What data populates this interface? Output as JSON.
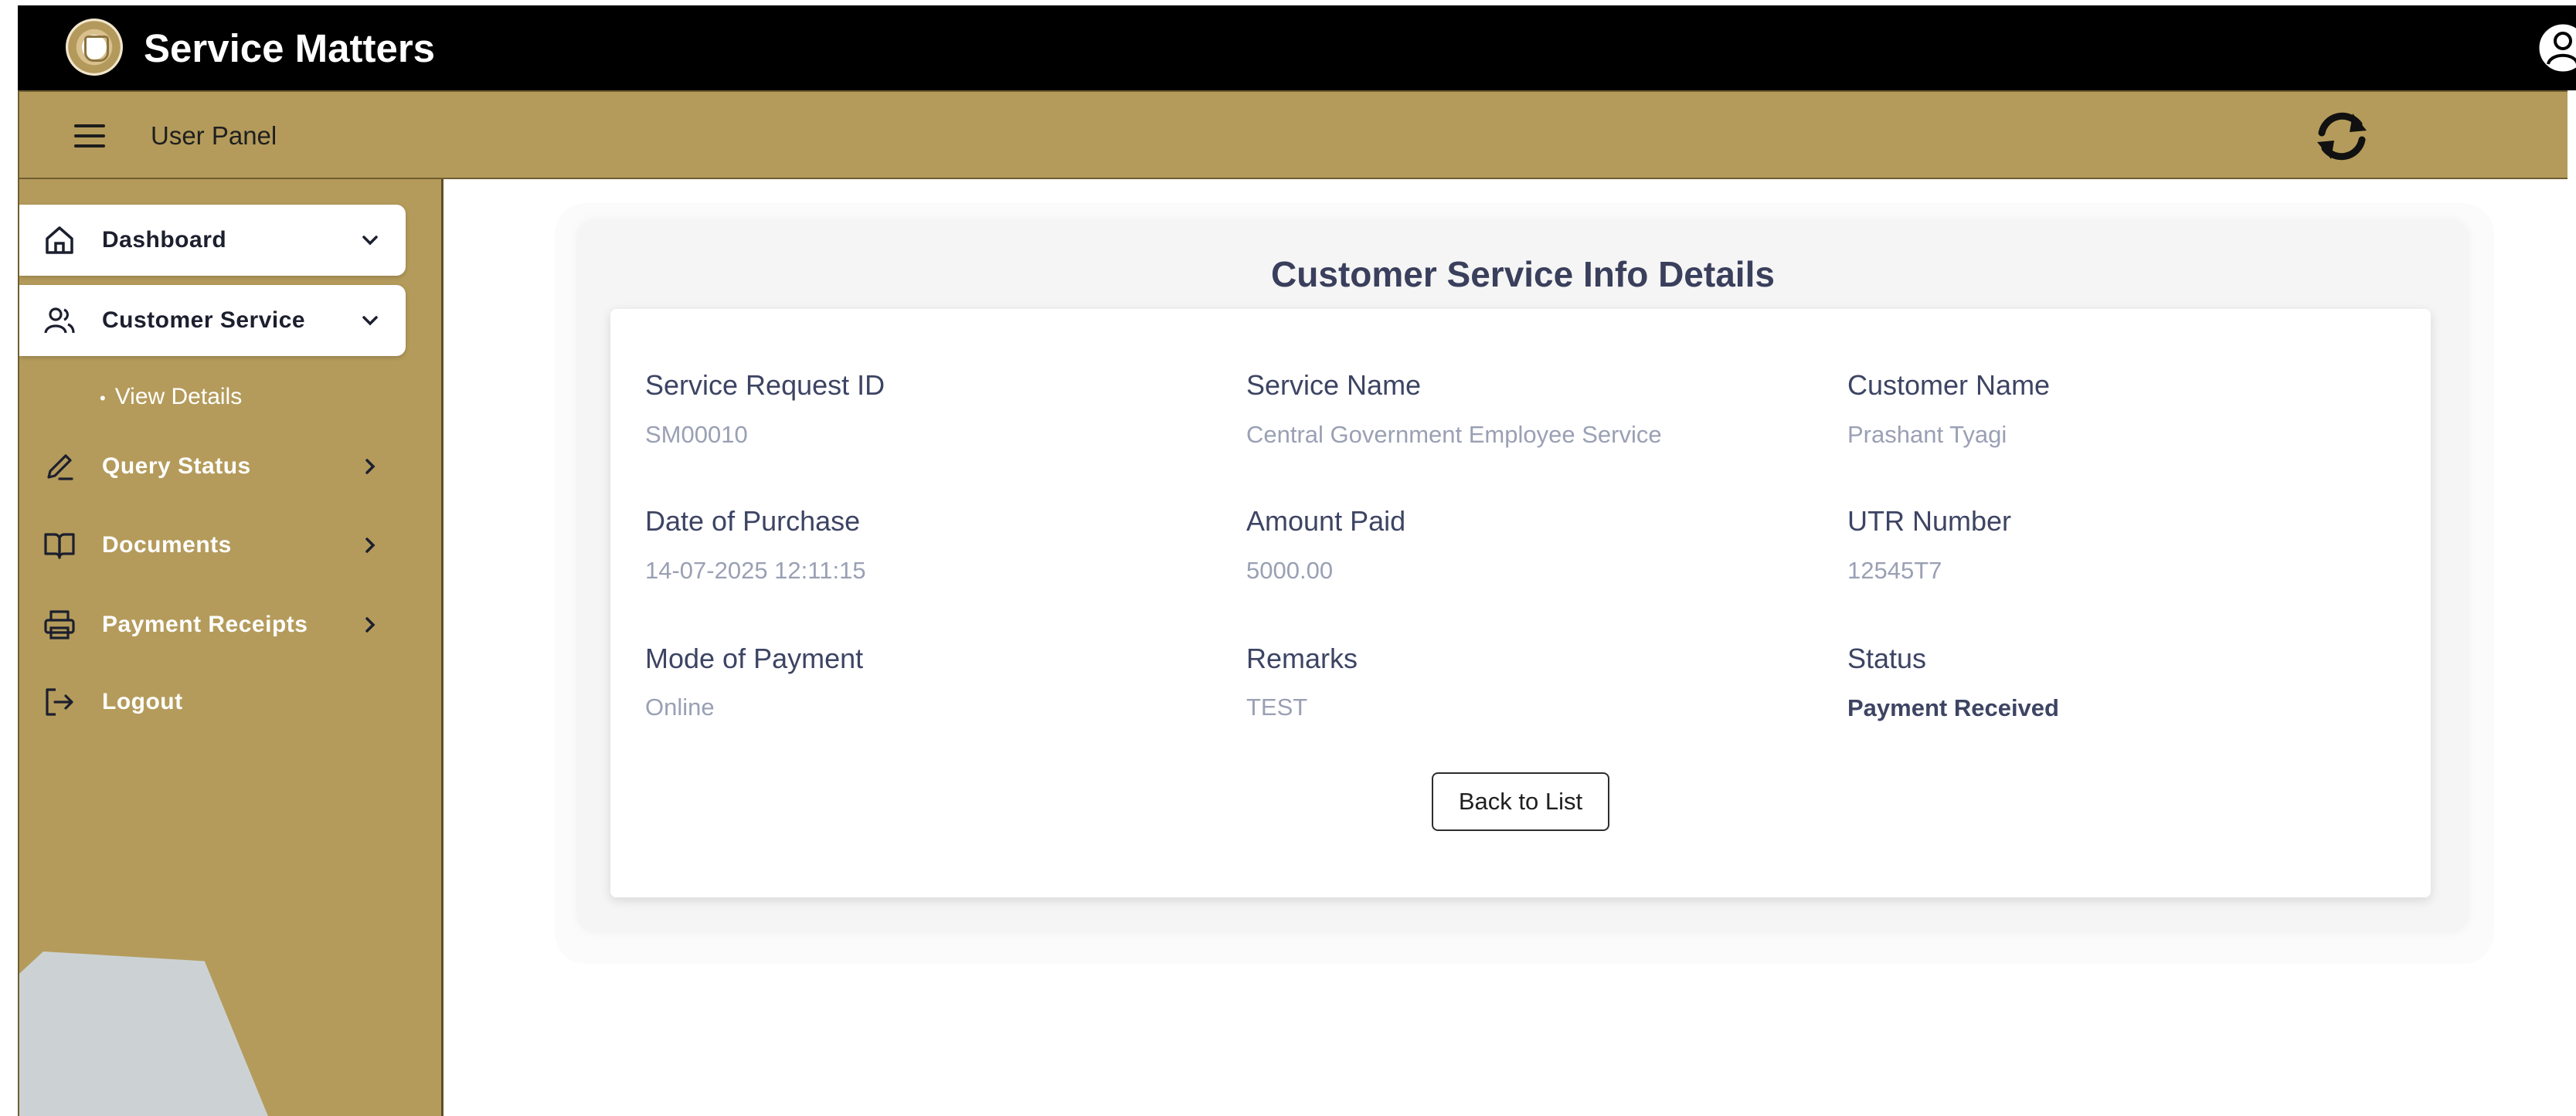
{
  "app": {
    "brand": "Service Matters",
    "panel_label": "User Panel",
    "icons": {
      "logo": "emblem-logo-icon",
      "user": "user-circle-icon",
      "menu": "hamburger-menu-icon",
      "refresh": "refresh-icon"
    }
  },
  "sidebar": {
    "items": [
      {
        "label": "Dashboard",
        "icon": "home-icon",
        "arrow": "chevron-down-icon"
      },
      {
        "label": "Customer Service",
        "icon": "users-icon",
        "arrow": "chevron-down-icon"
      },
      {
        "label": "Query Status",
        "icon": "pen-icon",
        "arrow": "chevron-right-icon"
      },
      {
        "label": "Documents",
        "icon": "book-open-icon",
        "arrow": "chevron-right-icon"
      },
      {
        "label": "Payment Receipts",
        "icon": "printer-icon",
        "arrow": "chevron-right-icon"
      },
      {
        "label": "Logout",
        "icon": "logout-icon"
      }
    ],
    "sub_items": [
      {
        "label": "View Details"
      }
    ]
  },
  "main": {
    "title": "Customer Service Info Details",
    "fields": [
      {
        "label": "Service Request ID",
        "value": "SM00010"
      },
      {
        "label": "Service Name",
        "value": "Central Government Employee Service"
      },
      {
        "label": "Customer Name",
        "value": "Prashant Tyagi"
      },
      {
        "label": "Date of Purchase",
        "value": "14-07-2025 12:11:15"
      },
      {
        "label": "Amount Paid",
        "value": "5000.00"
      },
      {
        "label": "UTR Number",
        "value": "12545T7"
      },
      {
        "label": "Mode of Payment",
        "value": "Online"
      },
      {
        "label": "Remarks",
        "value": "TEST"
      },
      {
        "label": "Status",
        "value": "Payment Received"
      }
    ],
    "back_button": "Back to List"
  },
  "colors": {
    "header": "#000000",
    "accent": "#b49b5b",
    "text": "#3d4463",
    "muted": "#9aa0b4"
  }
}
